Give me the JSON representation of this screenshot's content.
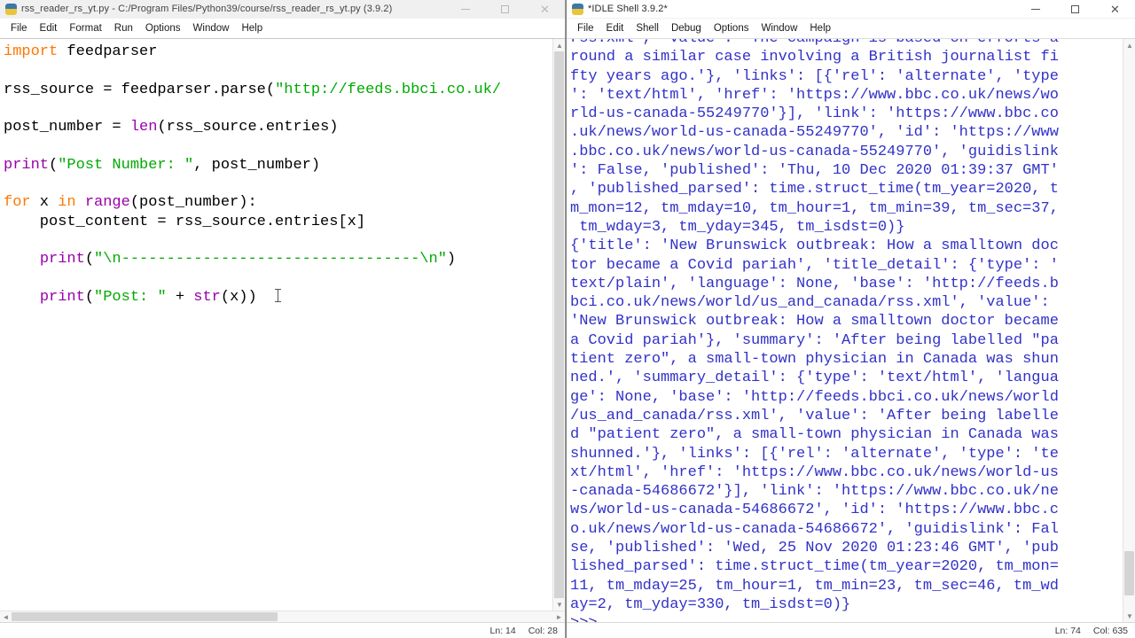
{
  "editor_window": {
    "app_icon": "python-idle-icon",
    "title": "rss_reader_rs_yt.py - C:/Program Files/Python39/course/rss_reader_rs_yt.py (3.9.2)",
    "menus": [
      "File",
      "Edit",
      "Format",
      "Run",
      "Options",
      "Window",
      "Help"
    ],
    "controls": {
      "minimize": "minimize-icon",
      "maximize": "maximize-icon",
      "close": "close-icon"
    },
    "status": {
      "line": "Ln: 14",
      "col": "Col: 28"
    },
    "code_lines": [
      [
        {
          "t": "import",
          "c": "kw"
        },
        {
          "t": " feedparser",
          "c": "plain"
        }
      ],
      [],
      [
        {
          "t": "rss_source = feedparser.parse(",
          "c": "plain"
        },
        {
          "t": "\"http://feeds.bbci.co.uk/",
          "c": "str"
        }
      ],
      [],
      [
        {
          "t": "post_number = ",
          "c": "plain"
        },
        {
          "t": "len",
          "c": "builtin"
        },
        {
          "t": "(rss_source.entries)",
          "c": "plain"
        }
      ],
      [],
      [
        {
          "t": "print",
          "c": "builtin"
        },
        {
          "t": "(",
          "c": "plain"
        },
        {
          "t": "\"Post Number: \"",
          "c": "str"
        },
        {
          "t": ", post_number)",
          "c": "plain"
        }
      ],
      [],
      [
        {
          "t": "for",
          "c": "kw"
        },
        {
          "t": " x ",
          "c": "plain"
        },
        {
          "t": "in",
          "c": "kw"
        },
        {
          "t": " ",
          "c": "plain"
        },
        {
          "t": "range",
          "c": "builtin"
        },
        {
          "t": "(post_number):",
          "c": "plain"
        }
      ],
      [
        {
          "t": "    post_content = rss_source.entries[x]",
          "c": "plain"
        }
      ],
      [],
      [
        {
          "t": "    ",
          "c": "plain"
        },
        {
          "t": "print",
          "c": "builtin"
        },
        {
          "t": "(",
          "c": "plain"
        },
        {
          "t": "\"\\n---------------------------------\\n\"",
          "c": "str"
        },
        {
          "t": ")",
          "c": "plain"
        }
      ],
      [],
      [
        {
          "t": "    ",
          "c": "plain"
        },
        {
          "t": "print",
          "c": "builtin"
        },
        {
          "t": "(",
          "c": "plain"
        },
        {
          "t": "\"Post: \"",
          "c": "str"
        },
        {
          "t": " + ",
          "c": "plain"
        },
        {
          "t": "str",
          "c": "builtin"
        },
        {
          "t": "(x))",
          "c": "plain"
        }
      ]
    ]
  },
  "shell_window": {
    "app_icon": "python-idle-icon",
    "title": "*IDLE Shell 3.9.2*",
    "menus": [
      "File",
      "Edit",
      "Shell",
      "Debug",
      "Options",
      "Window",
      "Help"
    ],
    "controls": {
      "minimize": "minimize-icon",
      "maximize": "maximize-icon",
      "close": "close-icon"
    },
    "status": {
      "line": "Ln: 74",
      "col": "Col: 635"
    },
    "output_lines": [
      "rss.xml', 'value': 'The campaign is based on efforts a",
      "round a similar case involving a British journalist fi",
      "fty years ago.'}, 'links': [{'rel': 'alternate', 'type",
      "': 'text/html', 'href': 'https://www.bbc.co.uk/news/wo",
      "rld-us-canada-55249770'}], 'link': 'https://www.bbc.co",
      ".uk/news/world-us-canada-55249770', 'id': 'https://www",
      ".bbc.co.uk/news/world-us-canada-55249770', 'guidislink",
      "': False, 'published': 'Thu, 10 Dec 2020 01:39:37 GMT'",
      ", 'published_parsed': time.struct_time(tm_year=2020, t",
      "m_mon=12, tm_mday=10, tm_hour=1, tm_min=39, tm_sec=37,",
      " tm_wday=3, tm_yday=345, tm_isdst=0)}",
      "{'title': 'New Brunswick outbreak: How a smalltown doc",
      "tor became a Covid pariah', 'title_detail': {'type': '",
      "text/plain', 'language': None, 'base': 'http://feeds.b",
      "bci.co.uk/news/world/us_and_canada/rss.xml', 'value':",
      "'New Brunswick outbreak: How a smalltown doctor became",
      "a Covid pariah'}, 'summary': 'After being labelled \"pa",
      "tient zero\", a small-town physician in Canada was shun",
      "ned.', 'summary_detail': {'type': 'text/html', 'langua",
      "ge': None, 'base': 'http://feeds.bbci.co.uk/news/world",
      "/us_and_canada/rss.xml', 'value': 'After being labelle",
      "d \"patient zero\", a small-town physician in Canada was",
      "shunned.'}, 'links': [{'rel': 'alternate', 'type': 'te",
      "xt/html', 'href': 'https://www.bbc.co.uk/news/world-us",
      "-canada-54686672'}], 'link': 'https://www.bbc.co.uk/ne",
      "ws/world-us-canada-54686672', 'id': 'https://www.bbc.c",
      "o.uk/news/world-us-canada-54686672', 'guidislink': Fal",
      "se, 'published': 'Wed, 25 Nov 2020 01:23:46 GMT', 'pub",
      "lished_parsed': time.struct_time(tm_year=2020, tm_mon=",
      "11, tm_mday=25, tm_hour=1, tm_min=23, tm_sec=46, tm_wd",
      "ay=2, tm_yday=330, tm_isdst=0)}"
    ],
    "prompt": ">>>"
  },
  "colors": {
    "keyword": "#ff7700",
    "builtin": "#9900aa",
    "string": "#00aa00",
    "shell_output": "#3232c8",
    "titlebar_bg": "#f0f0f0"
  }
}
